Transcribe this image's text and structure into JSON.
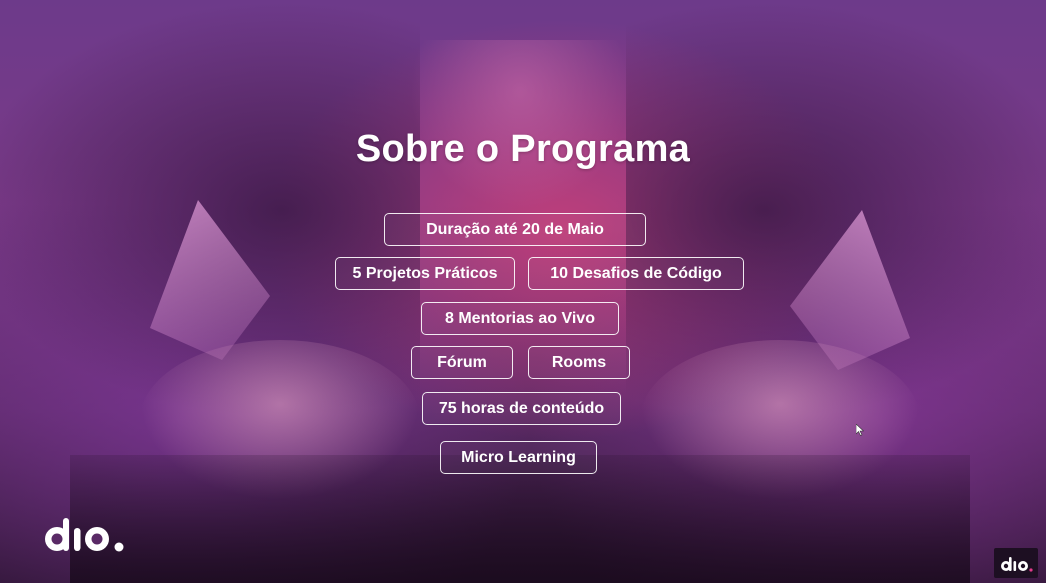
{
  "slide": {
    "title": "Sobre o Programa",
    "items": [
      "Duração até 20 de Maio",
      "5 Projetos Práticos",
      "10 Desafios de Código",
      "8 Mentorias ao Vivo",
      "Fórum",
      "Rooms",
      "75 horas de conteúdo",
      "Micro Learning"
    ]
  },
  "brand": {
    "logo_text": "dio.",
    "colors": {
      "accent": "#d6406f",
      "background": "#6d3a8a",
      "text": "#ffffff"
    }
  },
  "icons": [
    "dio-logo",
    "cursor-arrow-icon"
  ]
}
